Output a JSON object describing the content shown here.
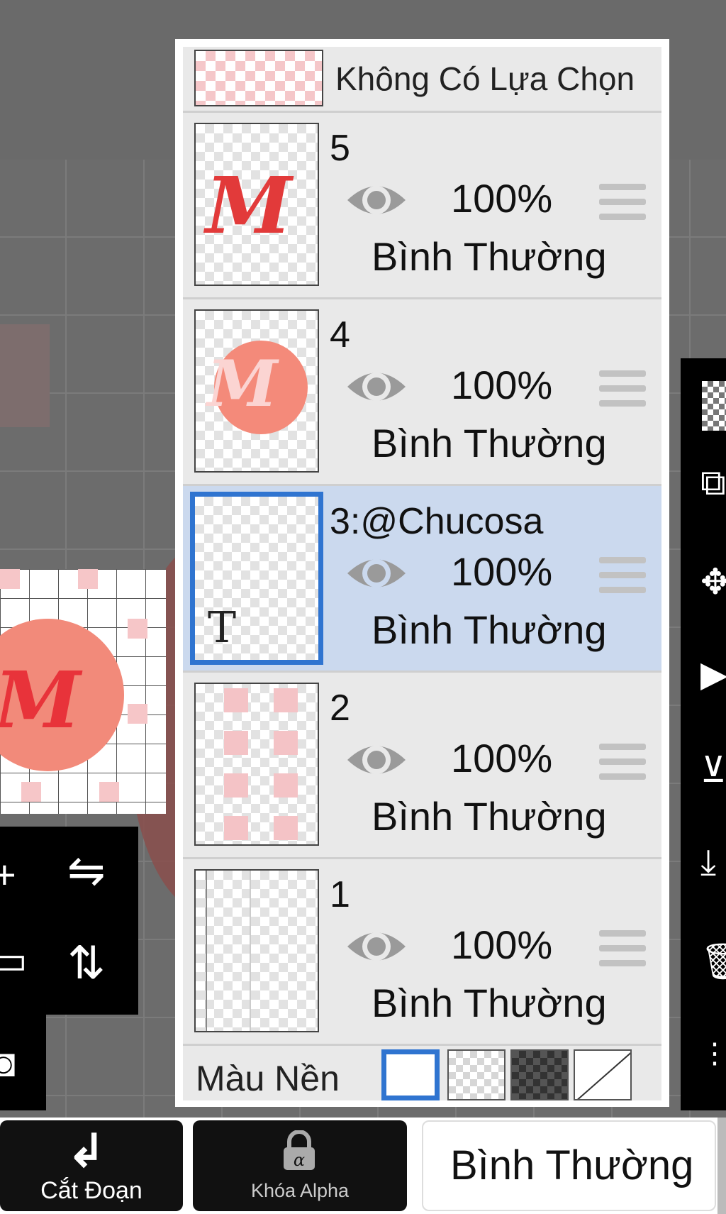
{
  "selection": {
    "label": "Không Có Lựa Chọn"
  },
  "layers": [
    {
      "name": "5",
      "opacity": "100%",
      "blend": "Bình Thường",
      "visible": true,
      "selected": false,
      "thumb": "red-m-lettering"
    },
    {
      "name": "4",
      "opacity": "100%",
      "blend": "Bình Thường",
      "visible": true,
      "selected": false,
      "thumb": "coral-circle"
    },
    {
      "name": "3:@Chucosa",
      "opacity": "100%",
      "blend": "Bình Thường",
      "visible": true,
      "selected": true,
      "thumb": "text-layer"
    },
    {
      "name": "2",
      "opacity": "100%",
      "blend": "Bình Thường",
      "visible": true,
      "selected": false,
      "thumb": "pink-squares"
    },
    {
      "name": "1",
      "opacity": "100%",
      "blend": "Bình Thường",
      "visible": true,
      "selected": false,
      "thumb": "lines"
    }
  ],
  "background": {
    "label": "Màu Nền",
    "options": [
      "white",
      "transparent",
      "dark-checker",
      "none"
    ],
    "selected": "white"
  },
  "bottom_bar": {
    "clipping_label": "Cắt Đoạn",
    "alpha_lock_label": "Khóa Alpha",
    "blend_mode_label": "Bình Thường"
  },
  "colors": {
    "selected_row": "#cbd9ee",
    "selection_border": "#2f74d0",
    "panel_bg": "#e9e9e9",
    "accent_red": "#e23a3a",
    "coral": "#f48a7a"
  }
}
